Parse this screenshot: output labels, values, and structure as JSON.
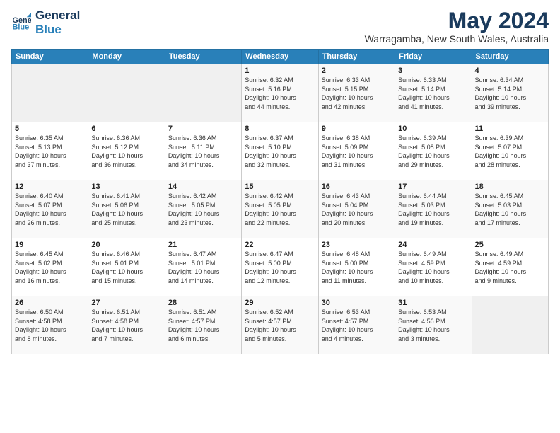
{
  "logo": {
    "line1": "General",
    "line2": "Blue"
  },
  "title": "May 2024",
  "location": "Warragamba, New South Wales, Australia",
  "days_of_week": [
    "Sunday",
    "Monday",
    "Tuesday",
    "Wednesday",
    "Thursday",
    "Friday",
    "Saturday"
  ],
  "weeks": [
    [
      {
        "day": "",
        "info": ""
      },
      {
        "day": "",
        "info": ""
      },
      {
        "day": "",
        "info": ""
      },
      {
        "day": "1",
        "info": "Sunrise: 6:32 AM\nSunset: 5:16 PM\nDaylight: 10 hours\nand 44 minutes."
      },
      {
        "day": "2",
        "info": "Sunrise: 6:33 AM\nSunset: 5:15 PM\nDaylight: 10 hours\nand 42 minutes."
      },
      {
        "day": "3",
        "info": "Sunrise: 6:33 AM\nSunset: 5:14 PM\nDaylight: 10 hours\nand 41 minutes."
      },
      {
        "day": "4",
        "info": "Sunrise: 6:34 AM\nSunset: 5:14 PM\nDaylight: 10 hours\nand 39 minutes."
      }
    ],
    [
      {
        "day": "5",
        "info": "Sunrise: 6:35 AM\nSunset: 5:13 PM\nDaylight: 10 hours\nand 37 minutes."
      },
      {
        "day": "6",
        "info": "Sunrise: 6:36 AM\nSunset: 5:12 PM\nDaylight: 10 hours\nand 36 minutes."
      },
      {
        "day": "7",
        "info": "Sunrise: 6:36 AM\nSunset: 5:11 PM\nDaylight: 10 hours\nand 34 minutes."
      },
      {
        "day": "8",
        "info": "Sunrise: 6:37 AM\nSunset: 5:10 PM\nDaylight: 10 hours\nand 32 minutes."
      },
      {
        "day": "9",
        "info": "Sunrise: 6:38 AM\nSunset: 5:09 PM\nDaylight: 10 hours\nand 31 minutes."
      },
      {
        "day": "10",
        "info": "Sunrise: 6:39 AM\nSunset: 5:08 PM\nDaylight: 10 hours\nand 29 minutes."
      },
      {
        "day": "11",
        "info": "Sunrise: 6:39 AM\nSunset: 5:07 PM\nDaylight: 10 hours\nand 28 minutes."
      }
    ],
    [
      {
        "day": "12",
        "info": "Sunrise: 6:40 AM\nSunset: 5:07 PM\nDaylight: 10 hours\nand 26 minutes."
      },
      {
        "day": "13",
        "info": "Sunrise: 6:41 AM\nSunset: 5:06 PM\nDaylight: 10 hours\nand 25 minutes."
      },
      {
        "day": "14",
        "info": "Sunrise: 6:42 AM\nSunset: 5:05 PM\nDaylight: 10 hours\nand 23 minutes."
      },
      {
        "day": "15",
        "info": "Sunrise: 6:42 AM\nSunset: 5:05 PM\nDaylight: 10 hours\nand 22 minutes."
      },
      {
        "day": "16",
        "info": "Sunrise: 6:43 AM\nSunset: 5:04 PM\nDaylight: 10 hours\nand 20 minutes."
      },
      {
        "day": "17",
        "info": "Sunrise: 6:44 AM\nSunset: 5:03 PM\nDaylight: 10 hours\nand 19 minutes."
      },
      {
        "day": "18",
        "info": "Sunrise: 6:45 AM\nSunset: 5:03 PM\nDaylight: 10 hours\nand 17 minutes."
      }
    ],
    [
      {
        "day": "19",
        "info": "Sunrise: 6:45 AM\nSunset: 5:02 PM\nDaylight: 10 hours\nand 16 minutes."
      },
      {
        "day": "20",
        "info": "Sunrise: 6:46 AM\nSunset: 5:01 PM\nDaylight: 10 hours\nand 15 minutes."
      },
      {
        "day": "21",
        "info": "Sunrise: 6:47 AM\nSunset: 5:01 PM\nDaylight: 10 hours\nand 14 minutes."
      },
      {
        "day": "22",
        "info": "Sunrise: 6:47 AM\nSunset: 5:00 PM\nDaylight: 10 hours\nand 12 minutes."
      },
      {
        "day": "23",
        "info": "Sunrise: 6:48 AM\nSunset: 5:00 PM\nDaylight: 10 hours\nand 11 minutes."
      },
      {
        "day": "24",
        "info": "Sunrise: 6:49 AM\nSunset: 4:59 PM\nDaylight: 10 hours\nand 10 minutes."
      },
      {
        "day": "25",
        "info": "Sunrise: 6:49 AM\nSunset: 4:59 PM\nDaylight: 10 hours\nand 9 minutes."
      }
    ],
    [
      {
        "day": "26",
        "info": "Sunrise: 6:50 AM\nSunset: 4:58 PM\nDaylight: 10 hours\nand 8 minutes."
      },
      {
        "day": "27",
        "info": "Sunrise: 6:51 AM\nSunset: 4:58 PM\nDaylight: 10 hours\nand 7 minutes."
      },
      {
        "day": "28",
        "info": "Sunrise: 6:51 AM\nSunset: 4:57 PM\nDaylight: 10 hours\nand 6 minutes."
      },
      {
        "day": "29",
        "info": "Sunrise: 6:52 AM\nSunset: 4:57 PM\nDaylight: 10 hours\nand 5 minutes."
      },
      {
        "day": "30",
        "info": "Sunrise: 6:53 AM\nSunset: 4:57 PM\nDaylight: 10 hours\nand 4 minutes."
      },
      {
        "day": "31",
        "info": "Sunrise: 6:53 AM\nSunset: 4:56 PM\nDaylight: 10 hours\nand 3 minutes."
      },
      {
        "day": "",
        "info": ""
      }
    ]
  ]
}
